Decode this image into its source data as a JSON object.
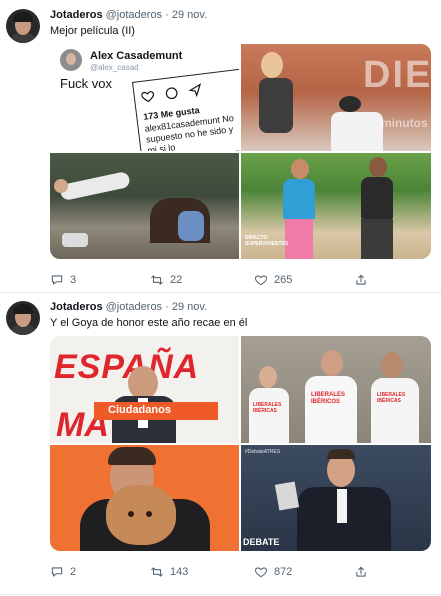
{
  "tweets": [
    {
      "name": "Jotaderos",
      "handle": "@jotaderos",
      "sep": "·",
      "date": "29 nov.",
      "text": "Mejor película (II)",
      "replies": "3",
      "retweets": "22",
      "likes": "265",
      "media": {
        "ig_name": "Alex Casademunt",
        "ig_handle": "@alex_casad",
        "ig_text": "Fuck vox",
        "ig_likes": "173 Me gusta",
        "ig_caption_1": "alex81casademunt No",
        "ig_caption_2": "supuesto no he sido y",
        "ig_caption_3": "mi si lo",
        "watermark": "DIEZ",
        "watermark_sub": "minutos",
        "tv_logo": "DIRECTO SUPERVIVIENTES"
      }
    },
    {
      "name": "Jotaderos",
      "handle": "@jotaderos",
      "sep": "·",
      "date": "29 nov.",
      "text": "Y el Goya de honor este año recae en él",
      "replies": "2",
      "retweets": "143",
      "likes": "872",
      "media": {
        "banner_top": "ESPAÑA",
        "banner_bottom": "MA",
        "party_label": "Ciudadanos",
        "shirt_1": "LIBERALES IBÉRICAS",
        "shirt_2": "LIBERALES IBÉRICOS",
        "shirt_3": "LIBERALES IBÉRICAS",
        "hashtag": "#DebateATRES",
        "debate_label": "DEBATE"
      }
    }
  ],
  "colors": {
    "text": "#0f1419",
    "meta": "#536471",
    "cs_orange": "#f05a28",
    "divider": "#e6ecf0"
  },
  "icons": [
    "reply-icon",
    "retweet-icon",
    "like-icon",
    "share-icon"
  ]
}
